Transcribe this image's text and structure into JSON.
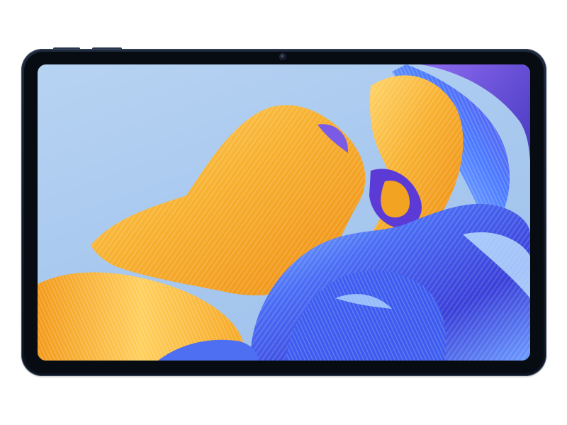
{
  "scene": {
    "subject": "tablet-device",
    "wallpaper_colors": {
      "background": "#a9c9ef",
      "orange": "#f6a21e",
      "yellow": "#ffd35a",
      "blue": "#3c5cf0",
      "violet": "#7a4fe0",
      "light_blue": "#8fc7ff",
      "frame": "#121a29"
    }
  }
}
